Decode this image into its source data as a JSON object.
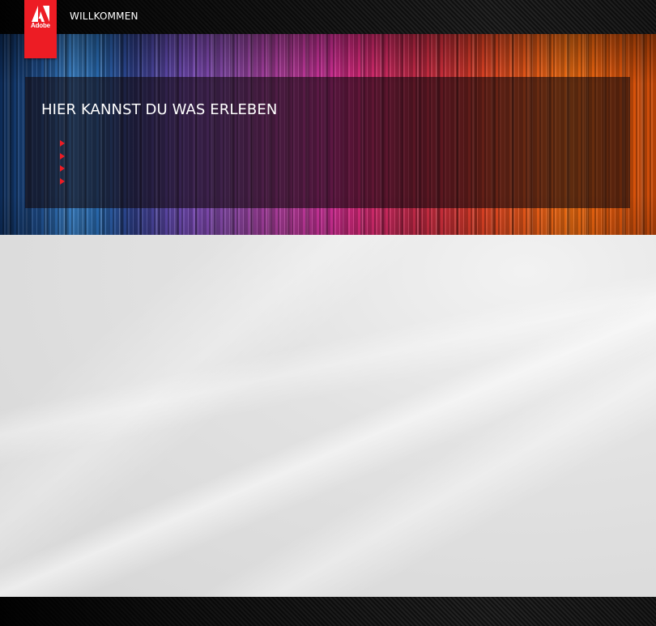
{
  "header": {
    "logo_text": "Adobe",
    "nav_label": "WILLKOMMEN"
  },
  "hero": {
    "title": "HIER KANNST DU WAS ERLEBEN",
    "bullets": [
      "",
      "",
      "",
      ""
    ]
  },
  "colors": {
    "brand_red": "#ed1c24"
  }
}
